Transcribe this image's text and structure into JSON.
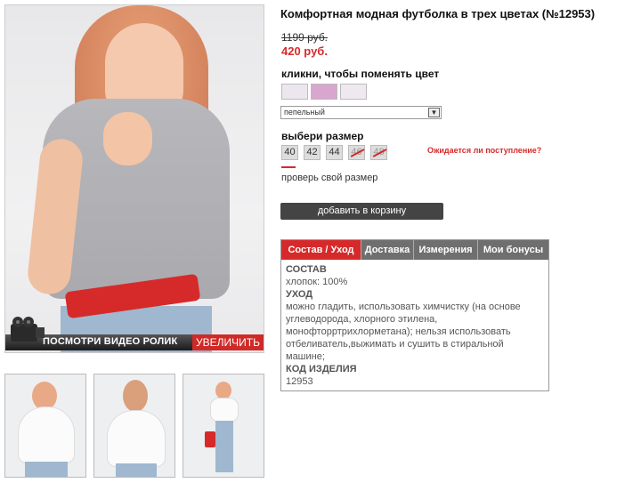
{
  "product": {
    "title": "Комфортная модная футболка в трех цветах (№12953)",
    "old_price": "1199 руб.",
    "new_price": "420 руб."
  },
  "image": {
    "video_label": "ПОСМОТРИ ВИДЕО РОЛИК",
    "zoom_label": "УВЕЛИЧИТЬ"
  },
  "colors": {
    "label": "кликни, чтобы поменять цвет",
    "swatches": [
      "#ece7ef",
      "#d8a6cf",
      "#efe9ef"
    ],
    "selected": "пепельный"
  },
  "sizes": {
    "label": "выбери размер",
    "items": [
      {
        "value": "40",
        "available": true
      },
      {
        "value": "42",
        "available": true
      },
      {
        "value": "44",
        "available": true
      },
      {
        "value": "46",
        "available": false
      },
      {
        "value": "48",
        "available": false
      }
    ],
    "arrival_link": "Ожидается ли поступление?",
    "check_size": "проверь свой размер"
  },
  "cart": {
    "label": "добавить в корзину"
  },
  "tabs": {
    "items": [
      "Состав / Уход",
      "Доставка",
      "Измерения",
      "Мои бонусы"
    ],
    "active": 0,
    "content": {
      "composition_title": "СОСТАВ",
      "composition": "хлопок: 100%",
      "care_title": "УХОД",
      "care": "можно гладить, использовать химчистку (на основе углеводорода, хлорного этилена, монофторртрихлорметана); нельзя использовать отбеливатель,выжимать и сушить в стиральной машине;",
      "code_title": "КОД ИЗДЕЛИЯ",
      "code": "12953"
    }
  },
  "colors_theme": {
    "accent": "#d62a2a",
    "dark_button": "#444444",
    "tab_bg": "#6f6f6f"
  }
}
